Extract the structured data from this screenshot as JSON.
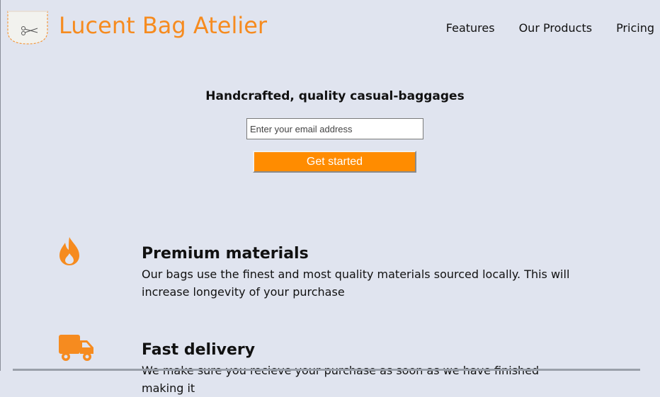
{
  "header": {
    "brand": "Lucent Bag Atelier",
    "logo_icon": "scissors-pocket-icon",
    "nav": [
      "Features",
      "Our Products",
      "Pricing"
    ]
  },
  "hero": {
    "title": "Handcrafted, quality casual-baggages",
    "email_placeholder": "Enter your email address",
    "cta_label": "Get started"
  },
  "features": [
    {
      "icon": "flame-icon",
      "title": "Premium materials",
      "text": "Our bags use the finest and most quality materials sourced locally. This will increase longevity of your purchase"
    },
    {
      "icon": "truck-icon",
      "title": "Fast delivery",
      "text": "We make sure you recieve your purchase as soon as we have finished making it"
    }
  ],
  "colors": {
    "accent": "#f68b1f",
    "button": "#ff8c00",
    "background": "#e0e4ef"
  }
}
